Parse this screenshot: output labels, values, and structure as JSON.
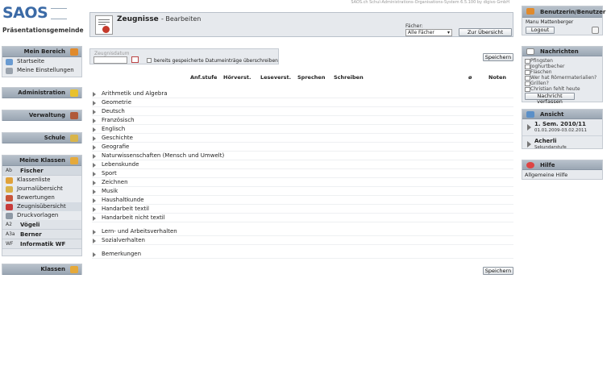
{
  "system_info": "SAOS.ch Schul-Administrations-Organisations-System 6.5.100 by digivo GmbH",
  "logo": {
    "brand": "SAOS",
    "institution": "Präsentationsgemeinde"
  },
  "sidebar": {
    "mein_bereich": {
      "title": "Mein Bereich",
      "items": [
        {
          "label": "Startseite"
        },
        {
          "label": "Meine Einstellungen"
        }
      ]
    },
    "administration": {
      "title": "Administration"
    },
    "verwaltung": {
      "title": "Verwaltung"
    },
    "schule": {
      "title": "Schule"
    },
    "meine_klassen": {
      "title": "Meine Klassen",
      "active_class": {
        "code": "Ab",
        "name": "Fischer"
      },
      "items": [
        {
          "label": "Klassenliste"
        },
        {
          "label": "Journalübersicht"
        },
        {
          "label": "Bewertungen"
        },
        {
          "label": "Zeugnisübersicht"
        },
        {
          "label": "Druckvorlagen"
        }
      ],
      "classes": [
        {
          "code": "A2",
          "name": "Vögeli"
        },
        {
          "code": "A3a",
          "name": "Berner"
        },
        {
          "code": "WF",
          "name": "Informatik WF"
        }
      ]
    },
    "klassen": {
      "title": "Klassen"
    }
  },
  "header": {
    "title": "Zeugnisse",
    "subtitle": "- Bearbeiten",
    "faecher_label": "Fächer:",
    "faecher_value": "Alle Fächer",
    "overview_button": "Zur Übersicht"
  },
  "date_form": {
    "placeholder": "Zeugnisdatum",
    "checkbox_label": "bereits gespeicherte Datumeinträge überschreiben"
  },
  "save_label": "Speichern",
  "columns": [
    "Anf.stufe",
    "Hörverst.",
    "Leseverst.",
    "Sprechen",
    "Schreiben",
    "ø",
    "Noten"
  ],
  "subjects": [
    "Arithmetik und Algebra",
    "Geometrie",
    "Deutsch",
    "Französisch",
    "Englisch",
    "Geschichte",
    "Geografie",
    "Naturwissenschaften (Mensch und Umwelt)",
    "Lebenskunde",
    "Sport",
    "Zeichnen",
    "Musik",
    "Haushaltkunde",
    "Handarbeit textil",
    "Handarbeit nicht textil"
  ],
  "behaviour": [
    "Lern- und Arbeitsverhalten",
    "Sozialverhalten"
  ],
  "remarks": "Bemerkungen",
  "right": {
    "user": {
      "title": "Benutzerin/Benutzer",
      "name": "Manu Mattenberger",
      "logout": "Logout"
    },
    "news": {
      "title": "Nachrichten",
      "items": [
        "Pfingsten",
        "Joghurtbecher",
        "Flaschen",
        "Wer hat Römermaterialien?",
        "Grillen?",
        "Christian fehlt heute"
      ],
      "compose": "Nachricht verfassen"
    },
    "ansicht": {
      "title": "Ansicht",
      "semester": "1. Sem. 2010/11",
      "semester_dates": "01.01.2009-03.02.2011",
      "school": "Acherli",
      "level": "Sekundarstufe"
    },
    "hilfe": {
      "title": "Hilfe",
      "item": "Allgemeine Hilfe"
    }
  },
  "colors": {
    "header_bg": "#a3aeba",
    "panel_bg": "#e7eaee",
    "brand": "#3b6aa6",
    "accent_red": "#c53a2b"
  }
}
